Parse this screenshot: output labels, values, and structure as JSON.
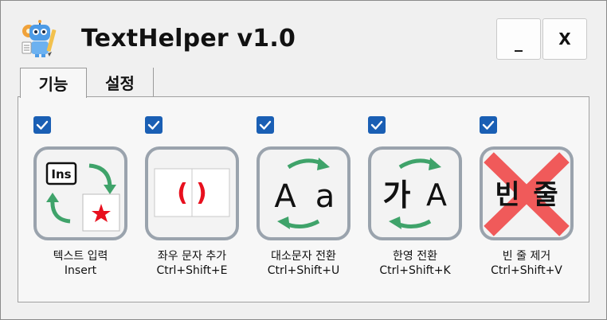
{
  "window": {
    "title": "TextHelper v1.0",
    "minimize_label": "_",
    "close_label": "X"
  },
  "tabs": [
    {
      "label": "기능",
      "active": true
    },
    {
      "label": "설정",
      "active": false
    }
  ],
  "features": [
    {
      "name": "텍스트 입력",
      "shortcut": "Insert",
      "checked": true,
      "icon": "text-insert-icon"
    },
    {
      "name": "좌우 문자 추가",
      "shortcut": "Ctrl+Shift+E",
      "checked": true,
      "icon": "wrap-chars-icon"
    },
    {
      "name": "대소문자 전환",
      "shortcut": "Ctrl+Shift+U",
      "checked": true,
      "icon": "case-toggle-icon"
    },
    {
      "name": "한영 전환",
      "shortcut": "Ctrl+Shift+K",
      "checked": true,
      "icon": "hangul-english-toggle-icon"
    },
    {
      "name": "빈 줄 제거",
      "shortcut": "Ctrl+Shift+V",
      "checked": true,
      "icon": "remove-blank-lines-icon"
    }
  ],
  "icon_text": {
    "ins": "Ins",
    "paren_left": "(",
    "paren_right": ")",
    "upper": "A",
    "lower": "a",
    "hangul": "가",
    "latin": "A",
    "bin": "빈",
    "jul": "줄"
  },
  "colors": {
    "checkbox": "#1a5fb4",
    "tile_border": "#9aa3ad",
    "arrow_green": "#3fa36a",
    "accent_red": "#e8101e",
    "cross_red": "#f05a5a"
  }
}
